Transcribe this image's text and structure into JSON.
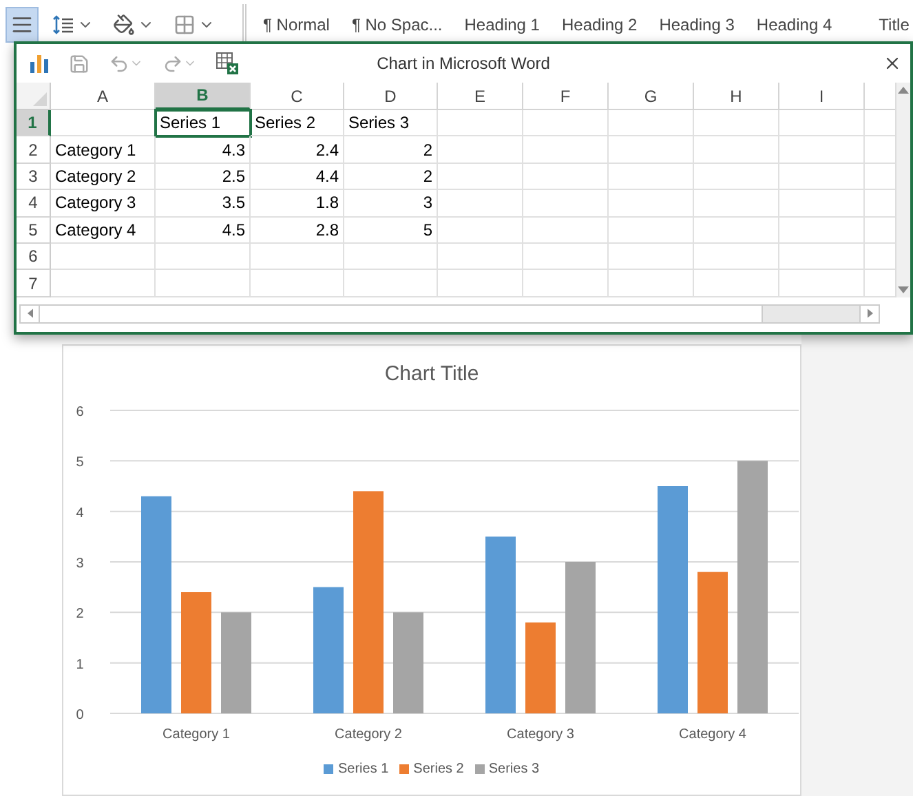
{
  "ribbon": {
    "paragraph_buttons": [
      {
        "kind": "justify",
        "selected": true
      },
      {
        "kind": "line-spacing",
        "selected": false
      },
      {
        "kind": "shading",
        "selected": false
      },
      {
        "kind": "borders",
        "selected": false
      }
    ],
    "styles": [
      "¶ Normal",
      "¶ No Spac...",
      "Heading 1",
      "Heading 2",
      "Heading 3",
      "Heading 4",
      "Title"
    ]
  },
  "window": {
    "title": "Chart in Microsoft Word",
    "grid": {
      "columns": [
        {
          "label": "A",
          "selected": false
        },
        {
          "label": "B",
          "selected": true
        },
        {
          "label": "C",
          "selected": false
        },
        {
          "label": "D",
          "selected": false
        },
        {
          "label": "E",
          "selected": false
        },
        {
          "label": "F",
          "selected": false
        },
        {
          "label": "G",
          "selected": false
        },
        {
          "label": "H",
          "selected": false
        },
        {
          "label": "I",
          "selected": false
        }
      ],
      "rows": [
        {
          "header": "1",
          "selected": true,
          "values": [
            {
              "text": "Series 1",
              "kind": "text",
              "selected": true
            },
            {
              "text": "Series 2",
              "kind": "text",
              "selected": false
            },
            {
              "text": "Series 3",
              "kind": "text",
              "selected": false
            }
          ]
        },
        {
          "header": "2",
          "selected": false,
          "label": "Category 1",
          "values": [
            {
              "text": "4.3",
              "kind": "number",
              "selected": false
            },
            {
              "text": "2.4",
              "kind": "number",
              "selected": false
            },
            {
              "text": "2",
              "kind": "number",
              "selected": false
            }
          ]
        },
        {
          "header": "3",
          "selected": false,
          "label": "Category 2",
          "values": [
            {
              "text": "2.5",
              "kind": "number",
              "selected": false
            },
            {
              "text": "4.4",
              "kind": "number",
              "selected": false
            },
            {
              "text": "2",
              "kind": "number",
              "selected": false
            }
          ]
        },
        {
          "header": "4",
          "selected": false,
          "label": "Category 3",
          "values": [
            {
              "text": "3.5",
              "kind": "number",
              "selected": false
            },
            {
              "text": "1.8",
              "kind": "number",
              "selected": false
            },
            {
              "text": "3",
              "kind": "number",
              "selected": false
            }
          ]
        },
        {
          "header": "5",
          "selected": false,
          "label": "Category 4",
          "values": [
            {
              "text": "4.5",
              "kind": "number",
              "selected": false
            },
            {
              "text": "2.8",
              "kind": "number",
              "selected": false
            },
            {
              "text": "5",
              "kind": "number",
              "selected": false
            }
          ]
        },
        {
          "header": "6",
          "selected": false
        },
        {
          "header": "7",
          "selected": false
        }
      ]
    }
  },
  "chart": {
    "chart_data": {
      "type": "bar",
      "title": "Chart Title",
      "categories": [
        "Category 1",
        "Category 2",
        "Category 3",
        "Category 4"
      ],
      "series": [
        {
          "name": "Series 1",
          "color": "#5b9bd5",
          "values": [
            4.3,
            2.5,
            3.5,
            4.5
          ]
        },
        {
          "name": "Series 2",
          "color": "#ed7d31",
          "values": [
            2.4,
            4.4,
            1.8,
            2.8
          ]
        },
        {
          "name": "Series 3",
          "color": "#a5a5a5",
          "values": [
            2,
            2,
            3,
            5
          ]
        }
      ],
      "ylim": [
        0,
        6
      ],
      "yticks": [
        0,
        1,
        2,
        3,
        4,
        5,
        6
      ],
      "grid": true
    }
  }
}
